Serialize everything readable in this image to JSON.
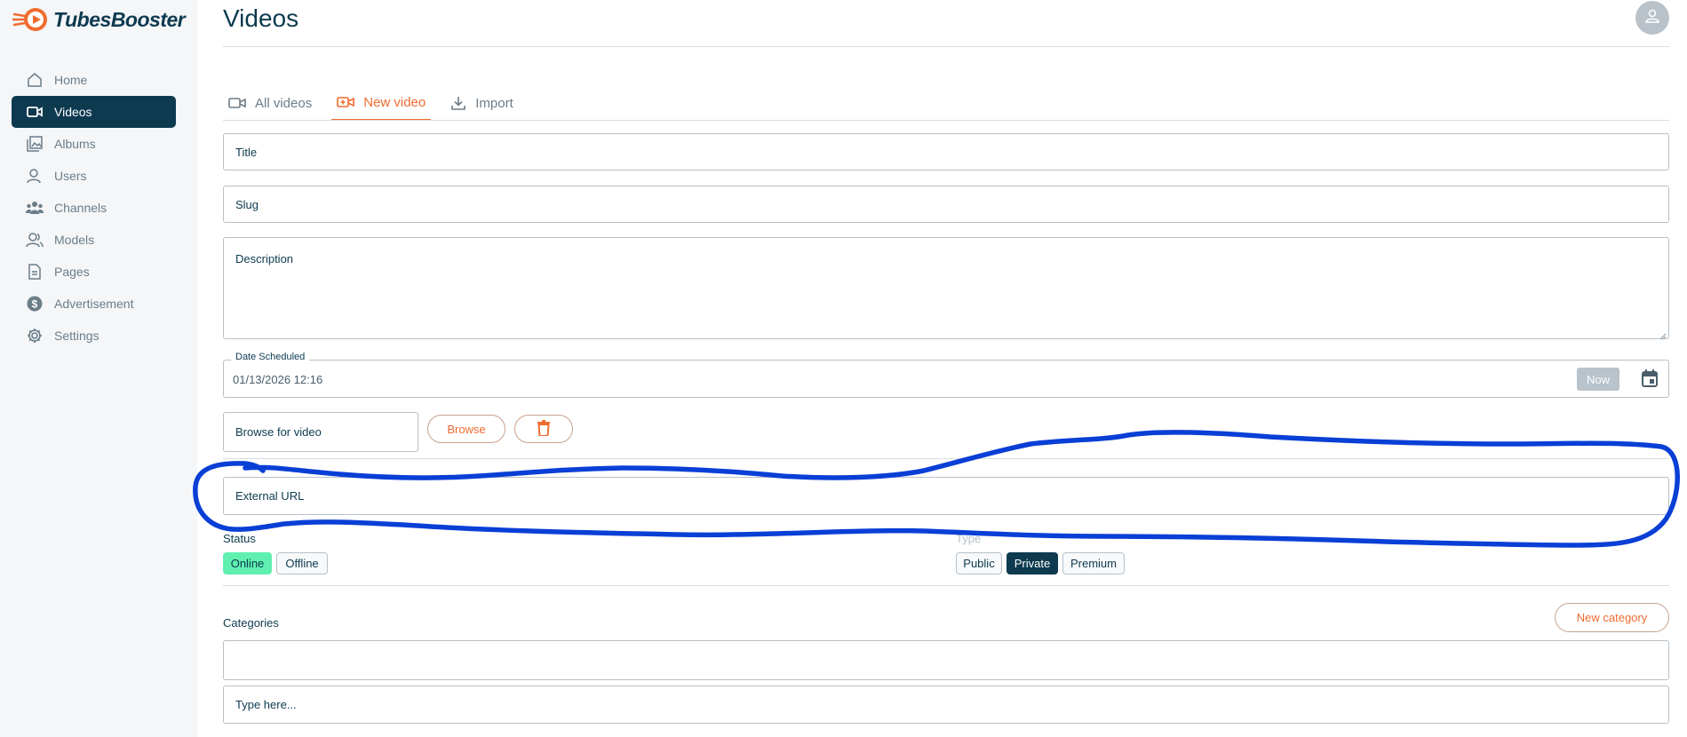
{
  "brand": {
    "name": "TubesBooster",
    "accent": "#ef6c2f",
    "dark": "#0d3a4f"
  },
  "sidebar": {
    "items": [
      {
        "label": "Home",
        "icon": "home-icon"
      },
      {
        "label": "Videos",
        "icon": "video-camera-icon"
      },
      {
        "label": "Albums",
        "icon": "image-stack-icon"
      },
      {
        "label": "Users",
        "icon": "user-icon"
      },
      {
        "label": "Channels",
        "icon": "users-group-icon"
      },
      {
        "label": "Models",
        "icon": "users-icon"
      },
      {
        "label": "Pages",
        "icon": "document-icon"
      },
      {
        "label": "Advertisement",
        "icon": "dollar-icon"
      },
      {
        "label": "Settings",
        "icon": "gear-icon"
      }
    ],
    "active": "Videos"
  },
  "header": {
    "title": "Videos"
  },
  "tabs": [
    {
      "label": "All videos"
    },
    {
      "label": "New video"
    },
    {
      "label": "Import"
    }
  ],
  "form": {
    "title_placeholder": "Title",
    "slug_placeholder": "Slug",
    "description_placeholder": "Description",
    "date_scheduled_label": "Date Scheduled",
    "date_scheduled_value": "01/13/2026 12:16",
    "now_label": "Now",
    "browse_placeholder": "Browse for video",
    "browse_button": "Browse",
    "external_url_placeholder": "External URL",
    "status_label": "Status",
    "status_options": [
      "Online",
      "Offline"
    ],
    "status_selected": "Online",
    "type_label": "Type",
    "type_options": [
      "Public",
      "Private",
      "Premium"
    ],
    "type_selected": "Private",
    "categories_label": "Categories",
    "new_category_button": "New category",
    "categories_input_placeholder": "Type here..."
  },
  "annotation": {
    "color": "#0a3fd6"
  }
}
